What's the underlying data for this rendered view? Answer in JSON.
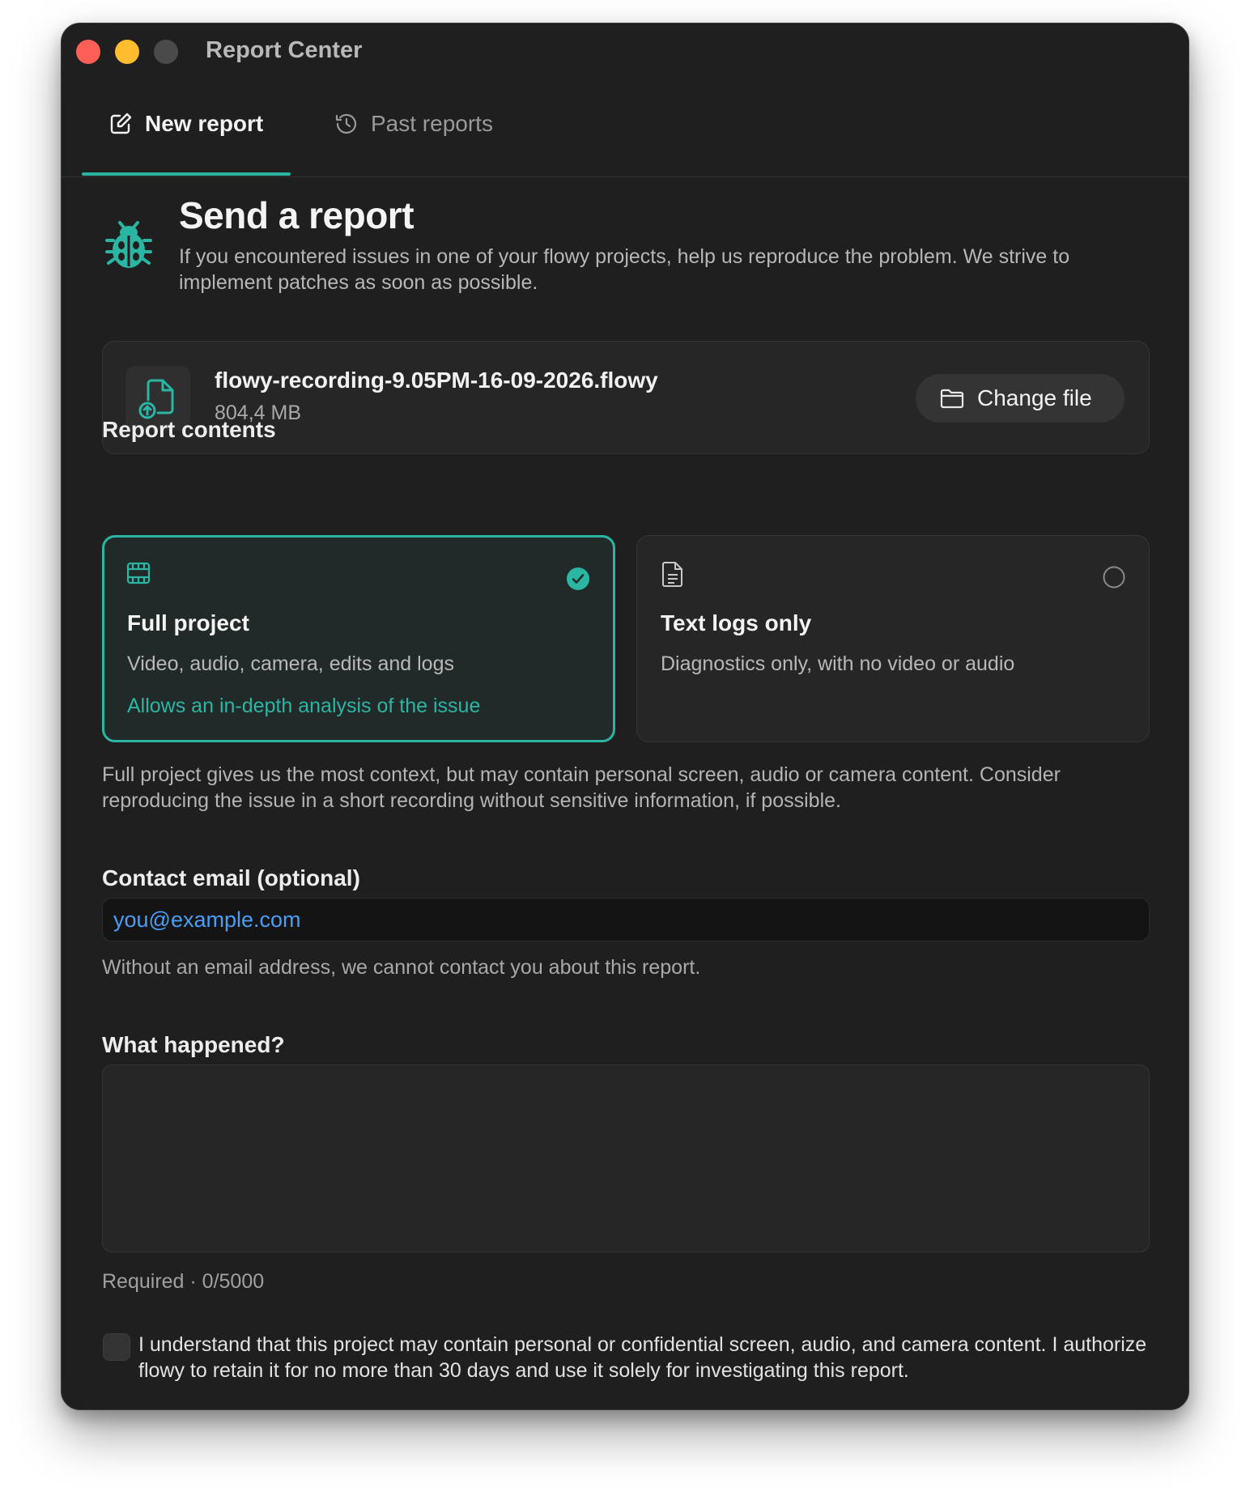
{
  "window": {
    "title": "Report Center"
  },
  "tabs": [
    {
      "label": "New report",
      "icon": "edit-icon",
      "active": true
    },
    {
      "label": "Past reports",
      "icon": "history-icon",
      "active": false
    }
  ],
  "header": {
    "icon": "bug-icon",
    "title": "Send a report",
    "description": "If you encountered issues in one of your flowy projects, help us reproduce the problem. We strive to implement patches as soon as possible."
  },
  "file": {
    "icon": "file-upload-icon",
    "name": "flowy-recording-9.05PM-16-09-2026.flowy",
    "size": "804,4 MB",
    "change_label": "Change file",
    "change_icon": "folder-icon"
  },
  "report_contents": {
    "label": "Report contents",
    "options": [
      {
        "icon": "film-icon",
        "title": "Full project",
        "description": "Video, audio, camera, edits and logs",
        "extra": "Allows an in-depth analysis of the issue",
        "selected": true
      },
      {
        "icon": "document-icon",
        "title": "Text logs only",
        "description": "Diagnostics only, with no video or audio",
        "selected": false
      }
    ],
    "note": "Full project gives us the most context, but may contain personal screen, audio or camera content. Consider reproducing the issue in a short recording without sensitive information, if possible."
  },
  "contact": {
    "label": "Contact email (optional)",
    "placeholder": "you@example.com",
    "hint": "Without an email address, we cannot contact you about this report."
  },
  "details": {
    "label": "What happened?",
    "value": "",
    "counter": "Required · 0/5000"
  },
  "consent": {
    "checked": false,
    "text": "I understand that this project may contain personal or confidential screen, audio, and camera content. I authorize flowy to retain it for no more than 30 days and use it solely for investigating this report."
  },
  "colors": {
    "accent": "#2bb5a3",
    "link": "#4a9ef5",
    "background": "#1f1f1f",
    "close": "#fe5f57",
    "minimize": "#febc2e"
  }
}
